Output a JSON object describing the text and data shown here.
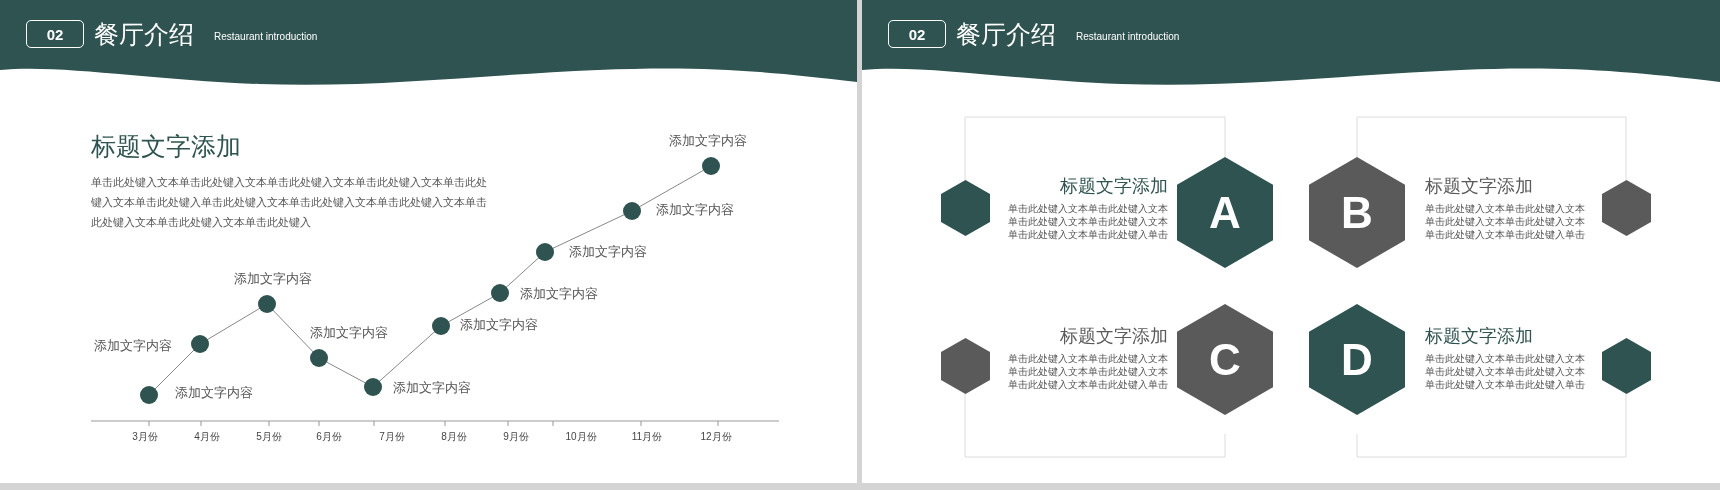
{
  "slides": [
    {
      "badge": "02",
      "title": "餐厅介绍",
      "subtitle": "Restaurant introduction",
      "heading": "标题文字添加",
      "body": "单击此处键入文本单击此处键入文本单击此处键入文本单击此处键入文本单击此处键入文本单击此处键入单击此处键入文本单击此处键入文本单击此处键入文本单击此处键入文本单击此处键入文本单击此处键入",
      "point_labels": [
        "添加文字内容",
        "添加文字内容",
        "添加文字内容",
        "添加文字内容",
        "添加文字内容",
        "添加文字内容",
        "添加文字内容",
        "添加文字内容",
        "添加文字内容",
        "添加文字内容"
      ],
      "months": [
        "3月份",
        "4月份",
        "5月份",
        "6月份",
        "7月份",
        "8月份",
        "9月份",
        "10月份",
        "11月份",
        "12月份"
      ]
    },
    {
      "badge": "02",
      "title": "餐厅介绍",
      "subtitle": "Restaurant introduction",
      "items": [
        {
          "letter": "A",
          "title": "标题文字添加",
          "body": "单击此处键入文本单击此处键入文本单击此处键入文本单击此处键入文本单击此处键入文本单击此处键入单击",
          "color": "#2f5350"
        },
        {
          "letter": "B",
          "title": "标题文字添加",
          "body": "单击此处键入文本单击此处键入文本单击此处键入文本单击此处键入文本单击此处键入文本单击此处键入单击",
          "color": "#5a5a5a"
        },
        {
          "letter": "C",
          "title": "标题文字添加",
          "body": "单击此处键入文本单击此处键入文本单击此处键入文本单击此处键入文本单击此处键入文本单击此处键入单击",
          "color": "#5a5a5a"
        },
        {
          "letter": "D",
          "title": "标题文字添加",
          "body": "单击此处键入文本单击此处键入文本单击此处键入文本单击此处键入文本单击此处键入文本单击此处键入单击",
          "color": "#2f5350"
        }
      ]
    }
  ]
}
